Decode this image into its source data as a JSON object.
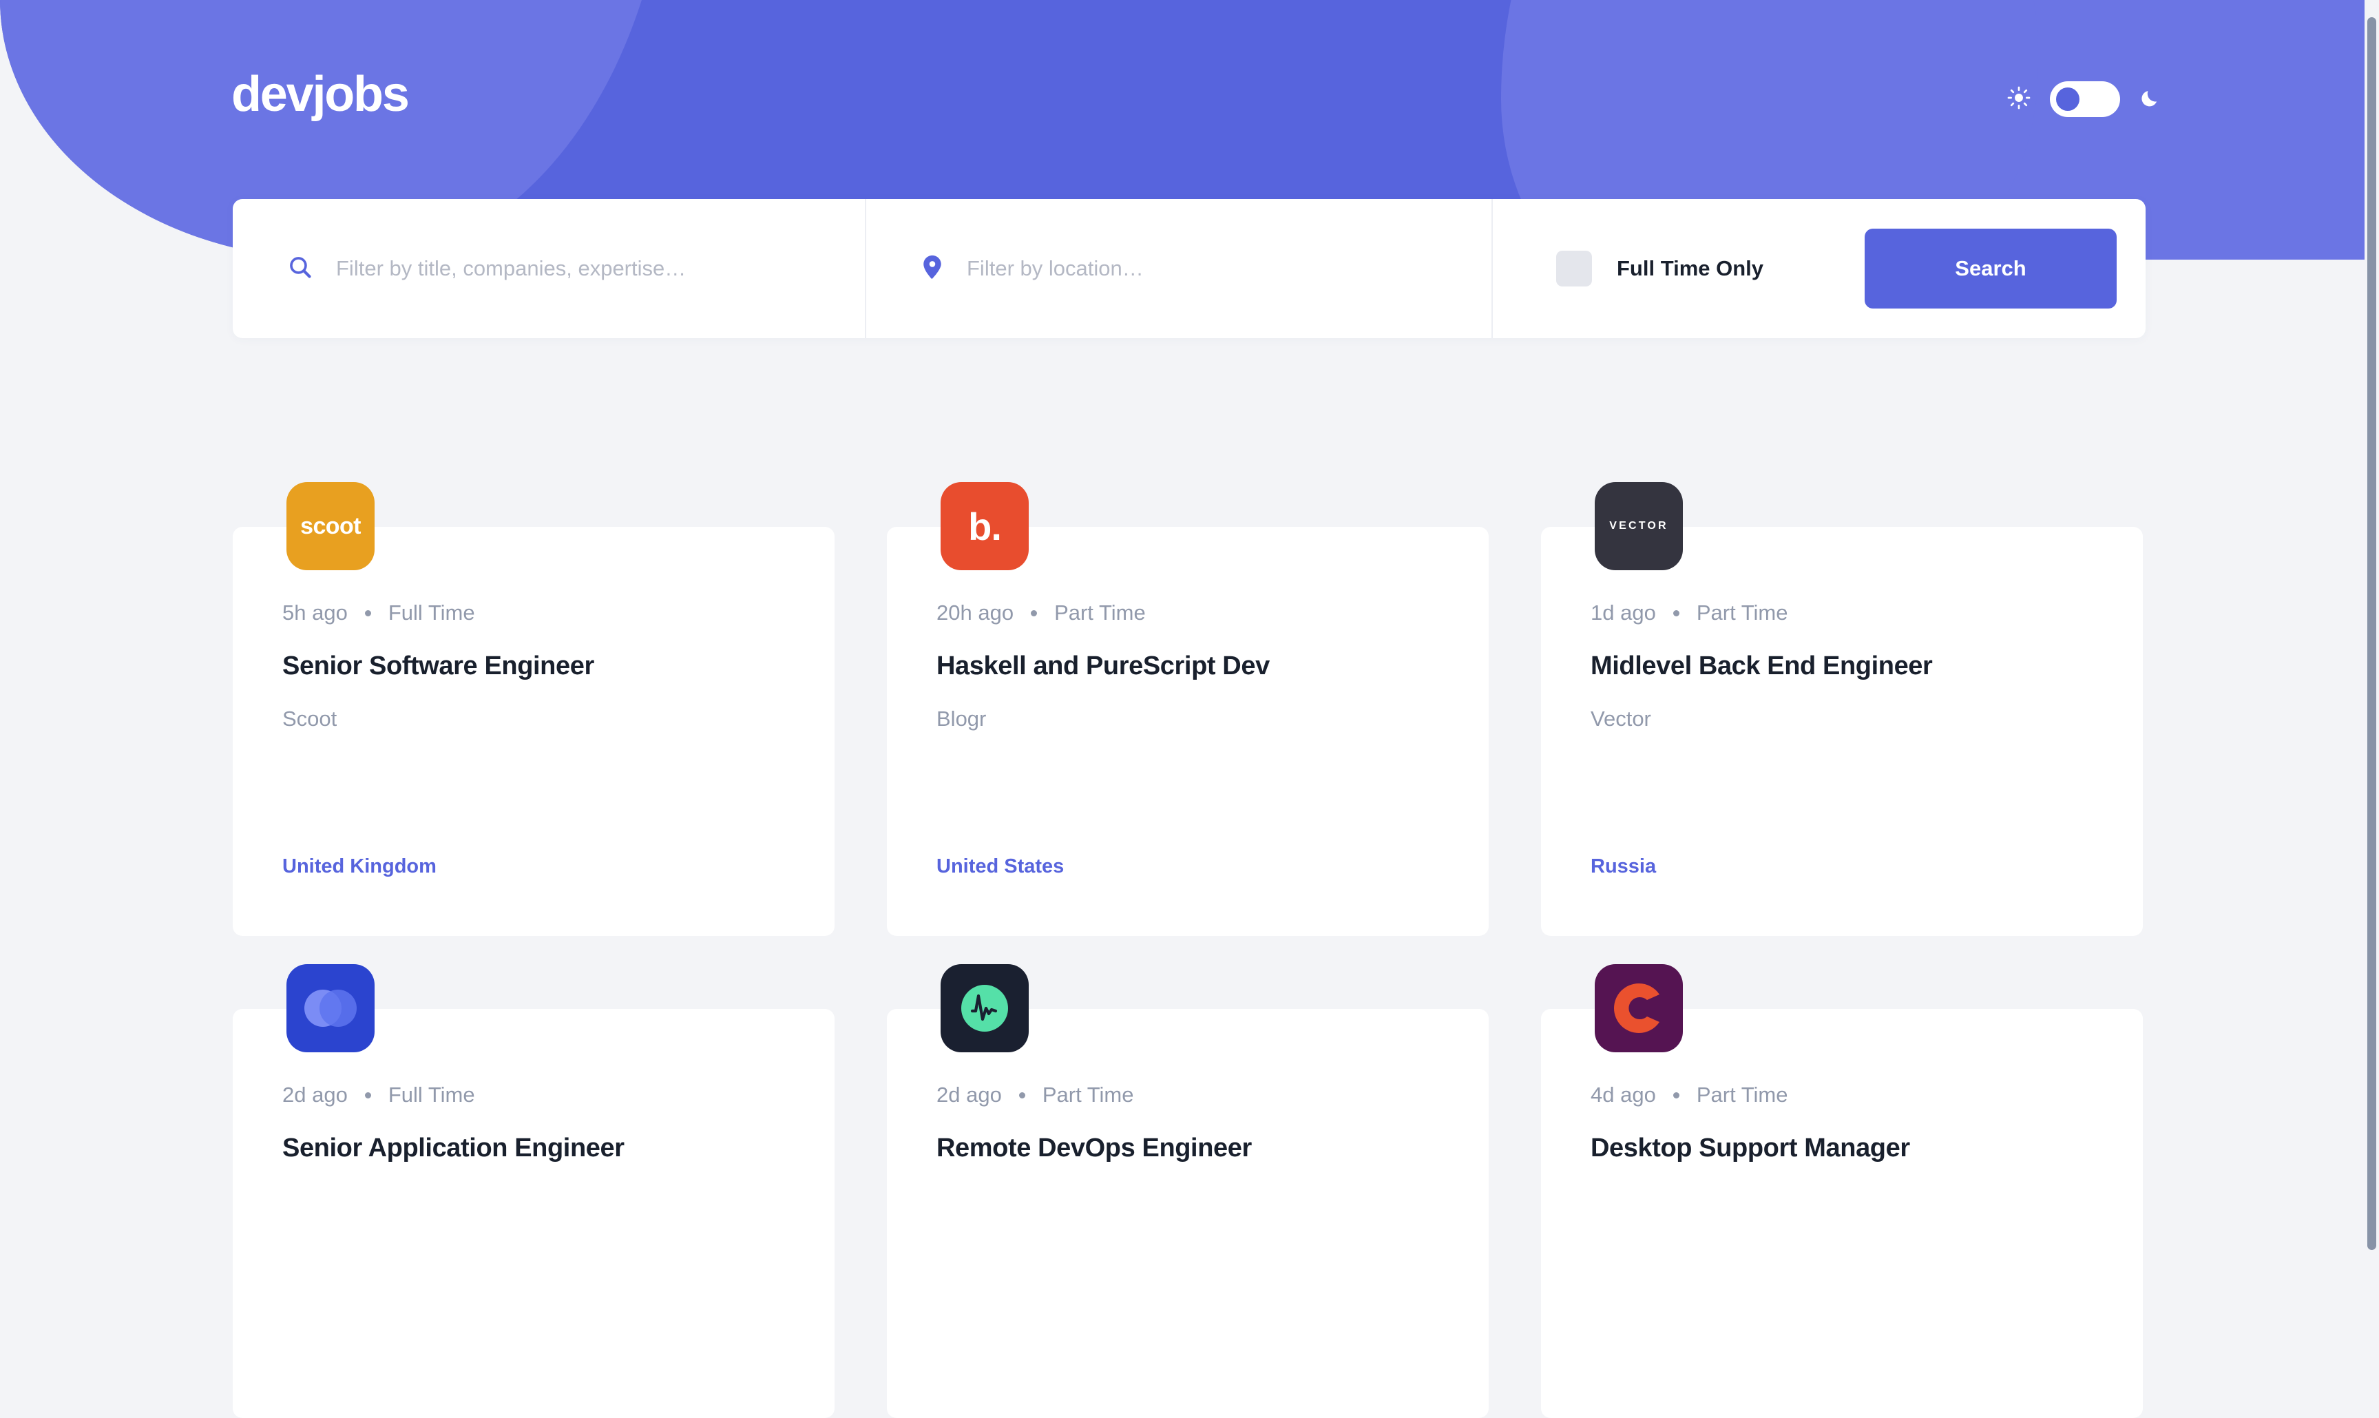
{
  "brand": {
    "logo_text": "devjobs",
    "accent_color": "#5764dd",
    "header_bg": "#5764dd",
    "header_deco_color": "#6b75e4",
    "page_bg": "#f3f4f7",
    "text_dark": "#19202d",
    "text_muted": "#9199ab"
  },
  "header": {
    "sun_icon": "sun-icon",
    "moon_icon": "moon-icon",
    "theme_toggle": {
      "icon_name": "theme-toggle",
      "state": "light",
      "knob_position": "left"
    }
  },
  "search": {
    "title_icon": "search-icon",
    "title_value": "",
    "title_placeholder": "Filter by title, companies, expertise…",
    "location_icon": "location-pin-icon",
    "location_value": "",
    "location_placeholder": "Filter by location…",
    "fulltime_checkbox": {
      "label": "Full Time Only",
      "checked": false
    },
    "search_button_label": "Search"
  },
  "jobs": [
    {
      "id": "scoot",
      "logo": {
        "icon_name": "scoot-logo",
        "bg": "#e8a020",
        "mark_kind": "text",
        "mark_text": "scoot",
        "mark_class": "mark-scoot"
      },
      "posted": "5h ago",
      "contract": "Full Time",
      "title": "Senior Software Engineer",
      "company": "Scoot",
      "country": "United Kingdom"
    },
    {
      "id": "blogr",
      "logo": {
        "icon_name": "blogr-logo",
        "bg": "#e84d2e",
        "mark_kind": "text",
        "mark_text": "b.",
        "mark_class": "mark-b"
      },
      "posted": "20h ago",
      "contract": "Part Time",
      "title": "Haskell and PureScript Dev",
      "company": "Blogr",
      "country": "United States"
    },
    {
      "id": "vector",
      "logo": {
        "icon_name": "vector-logo",
        "bg": "#34343f",
        "mark_kind": "text",
        "mark_text": "VECTOR",
        "mark_class": "mark-vector"
      },
      "posted": "1d ago",
      "contract": "Part Time",
      "title": "Midlevel Back End Engineer",
      "company": "Vector",
      "country": "Russia"
    },
    {
      "id": "officelite",
      "logo": {
        "icon_name": "officelite-logo",
        "bg": "#2b44cf",
        "mark_kind": "venn",
        "mark_text": "",
        "mark_class": ""
      },
      "posted": "2d ago",
      "contract": "Full Time",
      "title": "Senior Application Engineer",
      "company": "",
      "country": ""
    },
    {
      "id": "pulse",
      "logo": {
        "icon_name": "pulse-logo",
        "bg": "#1a2030",
        "mark_kind": "pulse",
        "mark_text": "",
        "mark_class": ""
      },
      "posted": "2d ago",
      "contract": "Part Time",
      "title": "Remote DevOps Engineer",
      "company": "",
      "country": ""
    },
    {
      "id": "crowdsource",
      "logo": {
        "icon_name": "crowdsource-logo",
        "bg": "#551452",
        "mark_kind": "c-ring",
        "mark_text": "",
        "mark_class": ""
      },
      "posted": "4d ago",
      "contract": "Part Time",
      "title": "Desktop Support Manager",
      "company": "",
      "country": ""
    }
  ],
  "scrollbar": {
    "name": "page-scrollbar",
    "position": "top"
  }
}
